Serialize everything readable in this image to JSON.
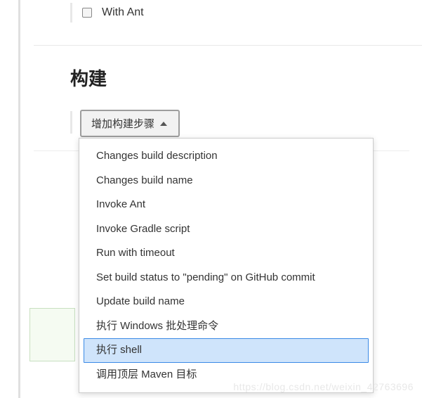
{
  "checkbox": {
    "label": "With Ant",
    "checked": false
  },
  "section": {
    "title": "构建"
  },
  "addStepButton": {
    "label": "增加构建步骤"
  },
  "dropdown": {
    "items": [
      {
        "label": "Changes build description",
        "highlighted": false
      },
      {
        "label": "Changes build name",
        "highlighted": false
      },
      {
        "label": "Invoke Ant",
        "highlighted": false
      },
      {
        "label": "Invoke Gradle script",
        "highlighted": false
      },
      {
        "label": "Run with timeout",
        "highlighted": false
      },
      {
        "label": "Set build status to \"pending\" on GitHub commit",
        "highlighted": false
      },
      {
        "label": "Update build name",
        "highlighted": false
      },
      {
        "label": "执行 Windows 批处理命令",
        "highlighted": false
      },
      {
        "label": "执行 shell",
        "highlighted": true
      },
      {
        "label": "调用顶层 Maven 目标",
        "highlighted": false
      }
    ]
  },
  "watermark": "https://blog.csdn.net/weixin_42763696"
}
